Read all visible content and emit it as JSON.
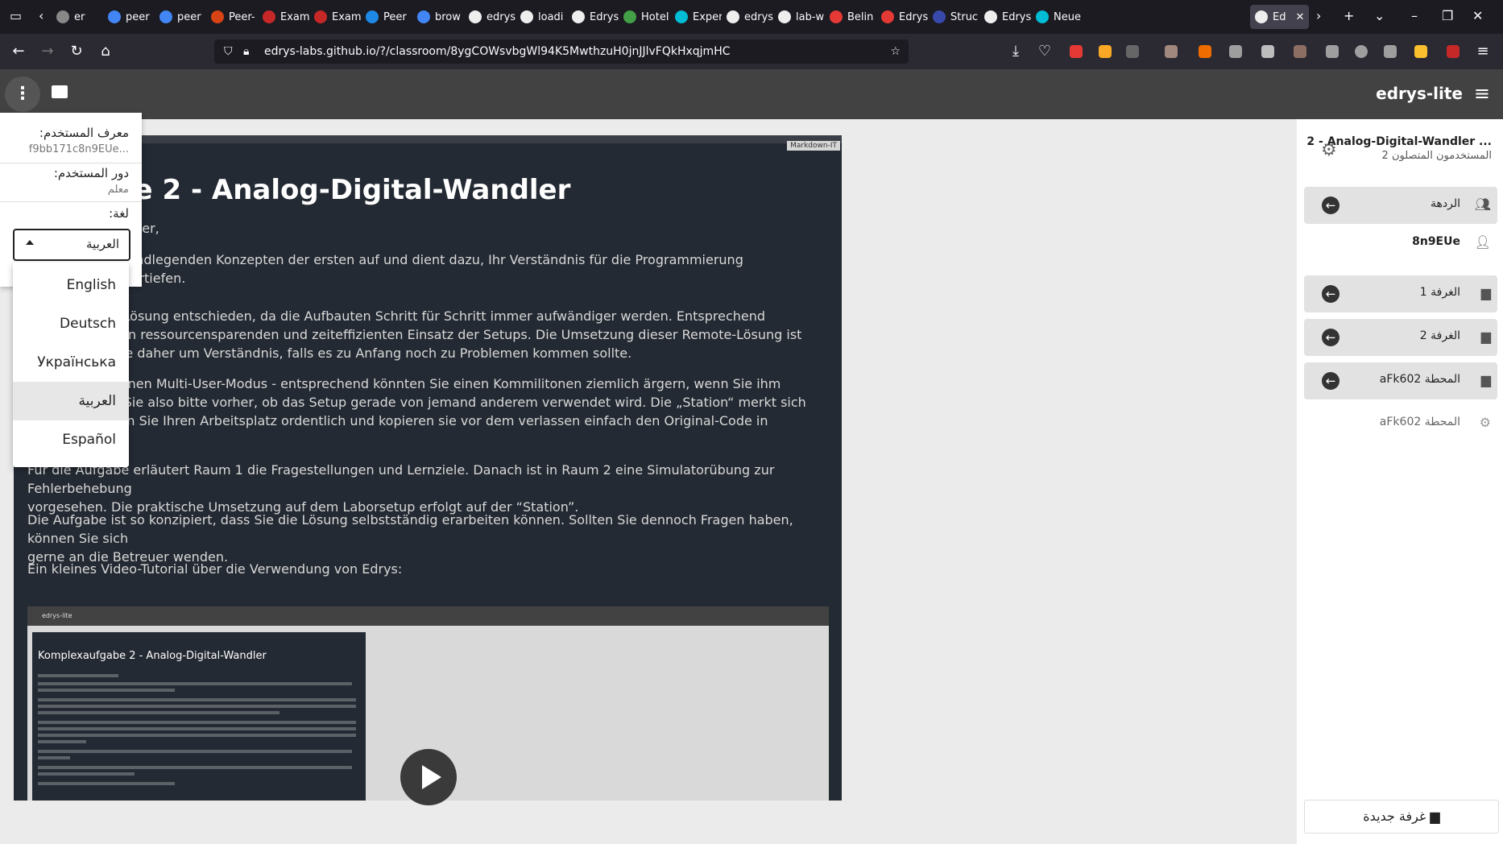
{
  "browser": {
    "tabs": [
      {
        "label": "er",
        "color": "#888"
      },
      {
        "label": "peer",
        "color": "#4285f4"
      },
      {
        "label": "peer",
        "color": "#4285f4"
      },
      {
        "label": "Peer-",
        "color": "#d84315"
      },
      {
        "label": "Exam",
        "color": "#c62828"
      },
      {
        "label": "Exam",
        "color": "#c62828"
      },
      {
        "label": "Peer",
        "color": "#1e88e5"
      },
      {
        "label": "brow",
        "color": "#4285f4"
      },
      {
        "label": "edrys",
        "color": "#eeeeee"
      },
      {
        "label": "loadi",
        "color": "#eeeeee"
      },
      {
        "label": "Edrys",
        "color": "#eeeeee"
      },
      {
        "label": "Hotel",
        "color": "#43a047"
      },
      {
        "label": "Exper",
        "color": "#00bcd4"
      },
      {
        "label": "edrys",
        "color": "#eeeeee"
      },
      {
        "label": "lab-w",
        "color": "#eeeeee"
      },
      {
        "label": "Belin",
        "color": "#e53935"
      },
      {
        "label": "Edrys",
        "color": "#e53935"
      },
      {
        "label": "Struc",
        "color": "#3949ab"
      },
      {
        "label": "Edrys",
        "color": "#eeeeee"
      },
      {
        "label": "Neue",
        "color": "#00bcd4"
      }
    ],
    "active_tab": "Ed",
    "url": "edrys-labs.github.io/?/classroom/8ygCOWsvbgWl94K5MwthzuH0jnJJlvFQkHxqjmHC"
  },
  "app": {
    "title": "edrys-lite",
    "menu": {
      "user_id_label": "معرف المستخدم:",
      "user_id_value": "f9bb171c8n9EUe...",
      "role_label": "دور المستخدم:",
      "role_value": "معلم",
      "language_label": "لغة:",
      "language_value": "العربية",
      "languages": [
        "English",
        "Deutsch",
        "Українська",
        "العربية",
        "Español"
      ],
      "selected_language": "العربية"
    },
    "module": {
      "badge": "Markdown-IT",
      "title": "aufgabe 2 - Analog-Digital-Wandler",
      "paragraphs": [
        "nen und Teilnehmer,",
        "baut auf den grundlegenden Konzepten der ersten auf und dient dazu, Ihr Verständnis für die Programmierung\neme weiter zu vertiefen.",
        "r eine Remote-Lösung entschieden, da die Aufbauten Schritt für Schritt immer aufwändiger werden. Entsprechend\nWebzugriff einen ressourcensparenden und zeiteffizienten Einsatz der Setups. Die Umsetzung dieser Remote-Lösung ist\nnd wir bitten Sie daher um Verständnis, falls es zu Anfang noch zu Problemen kommen sollte.",
        "sere Lösung keinen Multi-User-Modus - entsprechend könnten Sie einen Kommilitonen ziemlich ärgern, wenn Sie ihm\nziehen. Prüfen Sie also bitte vorher, ob das Setup gerade von jemand anderem verwendet wird. Die „Station“ merkt sich\nStand, verlassen Sie Ihren Arbeitsplatz ordentlich und kopieren sie vor dem verlassen einfach den Original-Code in",
        "Für die Aufgabe erläutert Raum 1 die Fragestellungen und Lernziele. Danach ist in Raum 2 eine Simulatorübung zur Fehlerbehebung\nvorgesehen. Die praktische Umsetzung auf dem Laborsetup erfolgt auf der “Station”.",
        "Die Aufgabe ist so konzipiert, dass Sie die Lösung selbstständig erarbeiten können. Sollten Sie dennoch Fragen haben, können Sie sich\ngerne an die Betreuer wenden.",
        "Ein kleines Video-Tutorial über die Verwendung von Edrys:"
      ],
      "video": {
        "bar_label": "edrys-lite",
        "inner_title": "Komplexaufgabe 2 - Analog-Digital-Wandler"
      }
    },
    "sidebar": {
      "class_title": "2 - Analog-Digital-Wandler ...",
      "connected_users": "المستخدمون المتصلون 2",
      "rooms": [
        {
          "name": "الردهة",
          "icon": "group-icon"
        },
        {
          "name": "الغرفة 1",
          "icon": "chat-icon"
        },
        {
          "name": "الغرفة 2",
          "icon": "chat-icon"
        },
        {
          "name": "المحطة aFk602",
          "icon": "chat-icon"
        }
      ],
      "users": [
        {
          "name": "8n9EUe",
          "icon": "person-add-icon"
        },
        {
          "name": "المحطة aFk602",
          "icon": "person-settings-icon"
        }
      ],
      "new_room": "غرفة جديدة"
    }
  }
}
